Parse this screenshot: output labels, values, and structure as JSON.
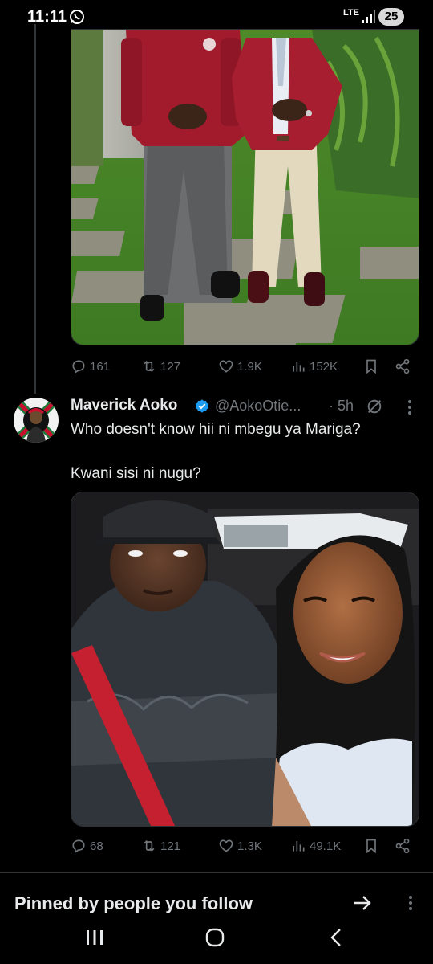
{
  "status_bar": {
    "time": "11:11",
    "network": "LTE",
    "battery": "25"
  },
  "tweet_1": {
    "stats": {
      "replies": "161",
      "retweets": "127",
      "likes": "1.9K",
      "views": "152K"
    }
  },
  "tweet_2": {
    "author": {
      "name": "Maverick Aoko",
      "handle": "@AokoOtie...",
      "time": "· 5h"
    },
    "text_line_1": "Who doesn't know hii ni mbegu ya Mariga?",
    "text_line_2": "Kwani sisi ni nugu?",
    "stats": {
      "replies": "68",
      "retweets": "121",
      "likes": "1.3K",
      "views": "49.1K"
    }
  },
  "pinned_section": {
    "title": "Pinned by people you follow"
  },
  "colors": {
    "background": "#000000",
    "text": "#e7e9ea",
    "muted": "#71767b",
    "verified": "#1d9bf0",
    "divider": "#2f3336"
  },
  "icons": {
    "reply": "reply-icon",
    "retweet": "retweet-icon",
    "like": "like-icon",
    "views": "views-icon",
    "bookmark": "bookmark-icon",
    "share": "share-icon",
    "grok": "grok-icon",
    "more": "more-icon"
  }
}
